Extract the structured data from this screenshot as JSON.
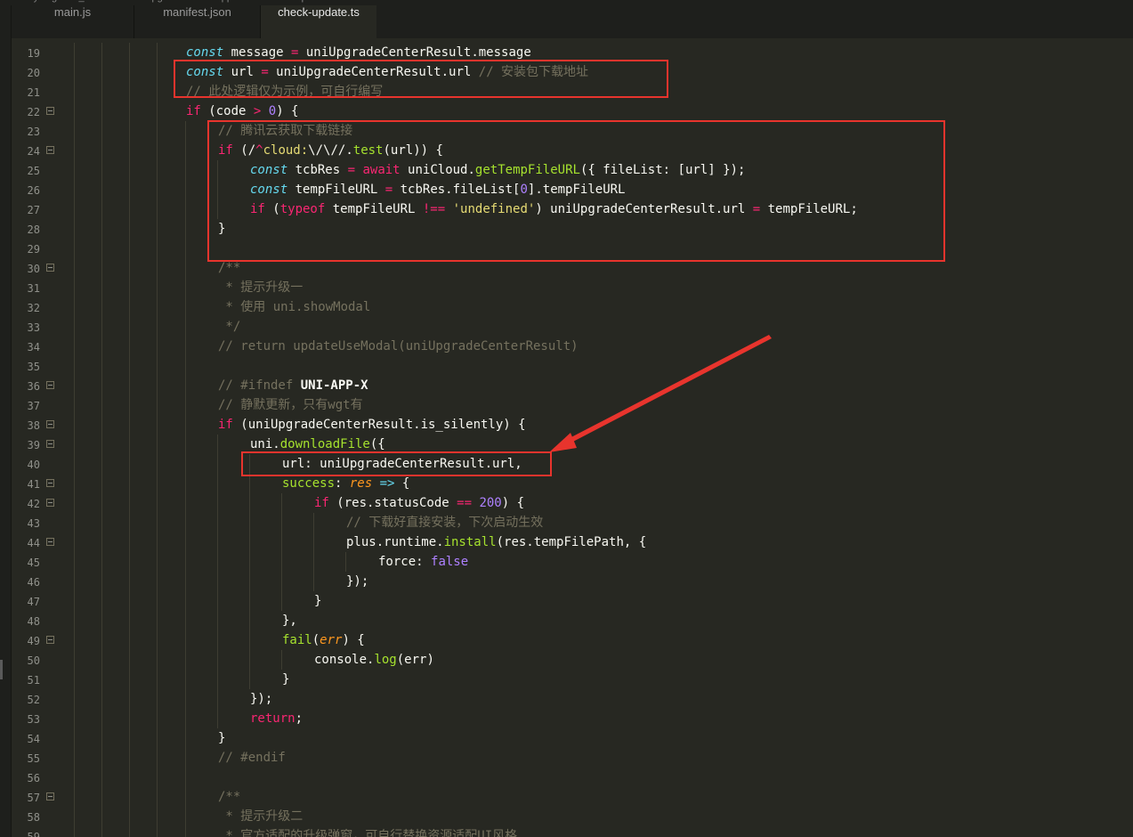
{
  "breadcrumb": [
    "Xiyiang",
    "uni_modules",
    "uni-upgrade-center-app",
    "utils",
    "check-update.ts"
  ],
  "tabs": [
    {
      "label": "main.js",
      "active": false
    },
    {
      "label": "manifest.json",
      "active": false
    },
    {
      "label": "check-update.ts",
      "active": true
    }
  ],
  "annotation_color": "#e8342d",
  "lines": [
    {
      "n": 19,
      "ind": 4,
      "fold": false,
      "tok": [
        [
          "s",
          "const"
        ],
        [
          "d",
          " message "
        ],
        [
          "k",
          "="
        ],
        [
          "d",
          " uniUpgradeCenterResult.message"
        ]
      ]
    },
    {
      "n": 20,
      "ind": 4,
      "fold": false,
      "tok": [
        [
          "s",
          "const"
        ],
        [
          "d",
          " url "
        ],
        [
          "k",
          "="
        ],
        [
          "d",
          " uniUpgradeCenterResult.url "
        ],
        [
          "c",
          "// 安装包下载地址"
        ]
      ]
    },
    {
      "n": 21,
      "ind": 4,
      "fold": false,
      "tok": [
        [
          "c",
          "// 此处逻辑仅为示例，可自行编写"
        ]
      ]
    },
    {
      "n": 22,
      "ind": 4,
      "fold": true,
      "tok": [
        [
          "k",
          "if"
        ],
        [
          "d",
          " (code "
        ],
        [
          "k",
          ">"
        ],
        [
          "d",
          " "
        ],
        [
          "n",
          "0"
        ],
        [
          "d",
          ") {"
        ]
      ]
    },
    {
      "n": 23,
      "ind": 5,
      "fold": false,
      "tok": [
        [
          "c",
          "// 腾讯云获取下载链接"
        ]
      ]
    },
    {
      "n": 24,
      "ind": 5,
      "fold": true,
      "tok": [
        [
          "k",
          "if"
        ],
        [
          "d",
          " (/"
        ],
        [
          "k",
          "^"
        ],
        [
          "str",
          "cloud:"
        ],
        [
          "d",
          "\\/\\//"
        ],
        [
          "d",
          "."
        ],
        [
          "f",
          "test"
        ],
        [
          "d",
          "(url)) {"
        ]
      ]
    },
    {
      "n": 25,
      "ind": 6,
      "fold": false,
      "tok": [
        [
          "s",
          "const"
        ],
        [
          "d",
          " tcbRes "
        ],
        [
          "k",
          "="
        ],
        [
          "d",
          " "
        ],
        [
          "k",
          "await"
        ],
        [
          "d",
          " uniCloud."
        ],
        [
          "f",
          "getTempFileURL"
        ],
        [
          "d",
          "({ fileList: [url] });"
        ]
      ]
    },
    {
      "n": 26,
      "ind": 6,
      "fold": false,
      "tok": [
        [
          "s",
          "const"
        ],
        [
          "d",
          " tempFileURL "
        ],
        [
          "k",
          "="
        ],
        [
          "d",
          " tcbRes.fileList["
        ],
        [
          "n",
          "0"
        ],
        [
          "d",
          "].tempFileURL"
        ]
      ]
    },
    {
      "n": 27,
      "ind": 6,
      "fold": false,
      "tok": [
        [
          "k",
          "if"
        ],
        [
          "d",
          " ("
        ],
        [
          "k",
          "typeof"
        ],
        [
          "d",
          " tempFileURL "
        ],
        [
          "k",
          "!=="
        ],
        [
          "d",
          " "
        ],
        [
          "str",
          "'undefined'"
        ],
        [
          "d",
          ") uniUpgradeCenterResult.url "
        ],
        [
          "k",
          "="
        ],
        [
          "d",
          " tempFileURL;"
        ]
      ]
    },
    {
      "n": 28,
      "ind": 5,
      "fold": false,
      "tok": [
        [
          "d",
          "}"
        ]
      ]
    },
    {
      "n": 29,
      "ind": 5,
      "fold": false,
      "tok": []
    },
    {
      "n": 30,
      "ind": 5,
      "fold": true,
      "tok": [
        [
          "c",
          "/**"
        ]
      ]
    },
    {
      "n": 31,
      "ind": 5,
      "fold": false,
      "tok": [
        [
          "c",
          " * 提示升级一"
        ]
      ]
    },
    {
      "n": 32,
      "ind": 5,
      "fold": false,
      "tok": [
        [
          "c",
          " * 使用 uni.showModal"
        ]
      ]
    },
    {
      "n": 33,
      "ind": 5,
      "fold": false,
      "tok": [
        [
          "c",
          " */"
        ]
      ]
    },
    {
      "n": 34,
      "ind": 5,
      "fold": false,
      "tok": [
        [
          "c",
          "// return updateUseModal(uniUpgradeCenterResult)"
        ]
      ]
    },
    {
      "n": 35,
      "ind": 5,
      "fold": false,
      "tok": []
    },
    {
      "n": 36,
      "ind": 5,
      "fold": true,
      "tok": [
        [
          "c",
          "// #ifndef "
        ],
        [
          "b",
          "UNI-APP-X"
        ]
      ]
    },
    {
      "n": 37,
      "ind": 5,
      "fold": false,
      "tok": [
        [
          "c",
          "// 静默更新，只有wgt有"
        ]
      ]
    },
    {
      "n": 38,
      "ind": 5,
      "fold": true,
      "tok": [
        [
          "k",
          "if"
        ],
        [
          "d",
          " (uniUpgradeCenterResult.is_silently) {"
        ]
      ]
    },
    {
      "n": 39,
      "ind": 6,
      "fold": true,
      "tok": [
        [
          "d",
          "uni."
        ],
        [
          "f",
          "downloadFile"
        ],
        [
          "d",
          "({"
        ]
      ]
    },
    {
      "n": 40,
      "ind": 7,
      "fold": false,
      "tok": [
        [
          "d",
          "url: uniUpgradeCenterResult.url,"
        ]
      ]
    },
    {
      "n": 41,
      "ind": 7,
      "fold": true,
      "tok": [
        [
          "f",
          "success"
        ],
        [
          "d",
          ": "
        ],
        [
          "p",
          "res"
        ],
        [
          "d",
          " "
        ],
        [
          "s",
          "=>"
        ],
        [
          "d",
          " {"
        ]
      ]
    },
    {
      "n": 42,
      "ind": 8,
      "fold": true,
      "tok": [
        [
          "k",
          "if"
        ],
        [
          "d",
          " (res.statusCode "
        ],
        [
          "k",
          "=="
        ],
        [
          "d",
          " "
        ],
        [
          "n",
          "200"
        ],
        [
          "d",
          ") {"
        ]
      ]
    },
    {
      "n": 43,
      "ind": 9,
      "fold": false,
      "tok": [
        [
          "c",
          "// 下载好直接安装，下次启动生效"
        ]
      ]
    },
    {
      "n": 44,
      "ind": 9,
      "fold": true,
      "tok": [
        [
          "d",
          "plus.runtime."
        ],
        [
          "f",
          "install"
        ],
        [
          "d",
          "(res.tempFilePath, {"
        ]
      ]
    },
    {
      "n": 45,
      "ind": 10,
      "fold": false,
      "tok": [
        [
          "d",
          "force: "
        ],
        [
          "n",
          "false"
        ]
      ]
    },
    {
      "n": 46,
      "ind": 9,
      "fold": false,
      "tok": [
        [
          "d",
          "});"
        ]
      ]
    },
    {
      "n": 47,
      "ind": 8,
      "fold": false,
      "tok": [
        [
          "d",
          "}"
        ]
      ]
    },
    {
      "n": 48,
      "ind": 7,
      "fold": false,
      "tok": [
        [
          "d",
          "},"
        ]
      ]
    },
    {
      "n": 49,
      "ind": 7,
      "fold": true,
      "tok": [
        [
          "f",
          "fail"
        ],
        [
          "d",
          "("
        ],
        [
          "p",
          "err"
        ],
        [
          "d",
          ") {"
        ]
      ]
    },
    {
      "n": 50,
      "ind": 8,
      "fold": false,
      "tok": [
        [
          "d",
          "console."
        ],
        [
          "f",
          "log"
        ],
        [
          "d",
          "(err)"
        ]
      ]
    },
    {
      "n": 51,
      "ind": 7,
      "fold": false,
      "tok": [
        [
          "d",
          "}"
        ]
      ]
    },
    {
      "n": 52,
      "ind": 6,
      "fold": false,
      "tok": [
        [
          "d",
          "});"
        ]
      ]
    },
    {
      "n": 53,
      "ind": 6,
      "fold": false,
      "tok": [
        [
          "k",
          "return"
        ],
        [
          "d",
          ";"
        ]
      ]
    },
    {
      "n": 54,
      "ind": 5,
      "fold": false,
      "tok": [
        [
          "d",
          "}"
        ]
      ]
    },
    {
      "n": 55,
      "ind": 5,
      "fold": false,
      "tok": [
        [
          "c",
          "// #endif"
        ]
      ]
    },
    {
      "n": 56,
      "ind": 5,
      "fold": false,
      "tok": []
    },
    {
      "n": 57,
      "ind": 5,
      "fold": true,
      "tok": [
        [
          "c",
          "/**"
        ]
      ]
    },
    {
      "n": 58,
      "ind": 5,
      "fold": false,
      "tok": [
        [
          "c",
          " * 提示升级二"
        ]
      ]
    },
    {
      "n": 59,
      "ind": 5,
      "fold": false,
      "tok": [
        [
          "c",
          " * 官方适配的升级弹窗，可自行替换资源适配UI风格"
        ]
      ]
    }
  ]
}
